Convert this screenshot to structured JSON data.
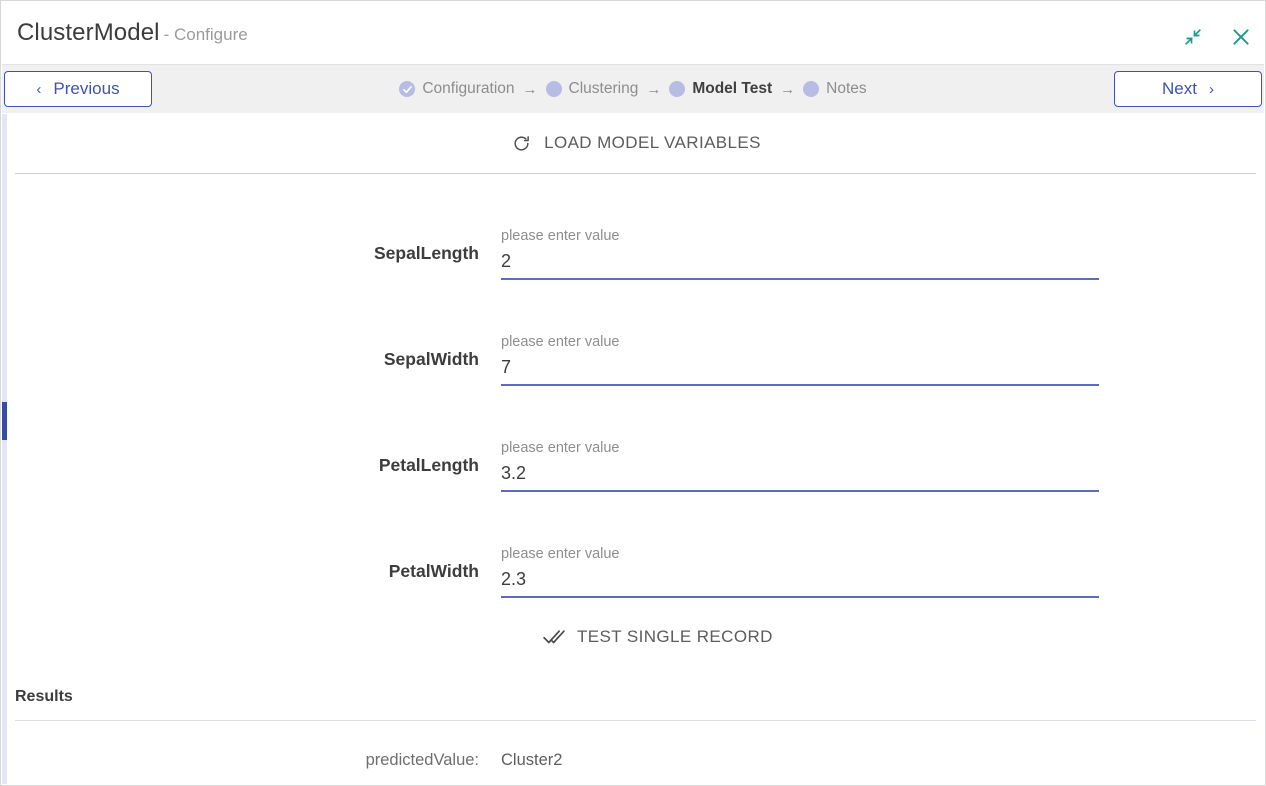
{
  "window": {
    "title_main": "ClusterModel",
    "title_sub": "- Configure",
    "collapse_icon": "collapse-arrows-icon",
    "close_icon": "close-icon"
  },
  "nav": {
    "previous_label": "Previous",
    "previous_chevron": "‹",
    "next_label": "Next",
    "next_chevron": "›",
    "accent_color": "#3f51b5"
  },
  "stepper": {
    "arrow": "→",
    "steps": [
      {
        "label": "Configuration",
        "state": "complete",
        "icon": "check-circle-icon"
      },
      {
        "label": "Clustering",
        "state": "done",
        "icon": "dot-icon"
      },
      {
        "label": "Model Test",
        "state": "active",
        "icon": "dot-icon"
      },
      {
        "label": "Notes",
        "state": "pending",
        "icon": "dot-icon"
      }
    ],
    "dot_color": "#b6bce4"
  },
  "main": {
    "load_button": {
      "label": "LOAD MODEL VARIABLES",
      "icon": "refresh-icon"
    },
    "fields": [
      {
        "label": "SepalLength",
        "hint": "please enter value",
        "value": "2"
      },
      {
        "label": "SepalWidth",
        "hint": "please enter value",
        "value": "7"
      },
      {
        "label": "PetalLength",
        "hint": "please enter value",
        "value": "3.2"
      },
      {
        "label": "PetalWidth",
        "hint": "please enter value",
        "value": "2.3"
      }
    ],
    "test_button": {
      "label": "TEST SINGLE RECORD",
      "icon": "double-check-icon"
    },
    "results": {
      "heading": "Results",
      "rows": [
        {
          "key": "predictedValue:",
          "value": "Cluster2"
        }
      ]
    }
  }
}
